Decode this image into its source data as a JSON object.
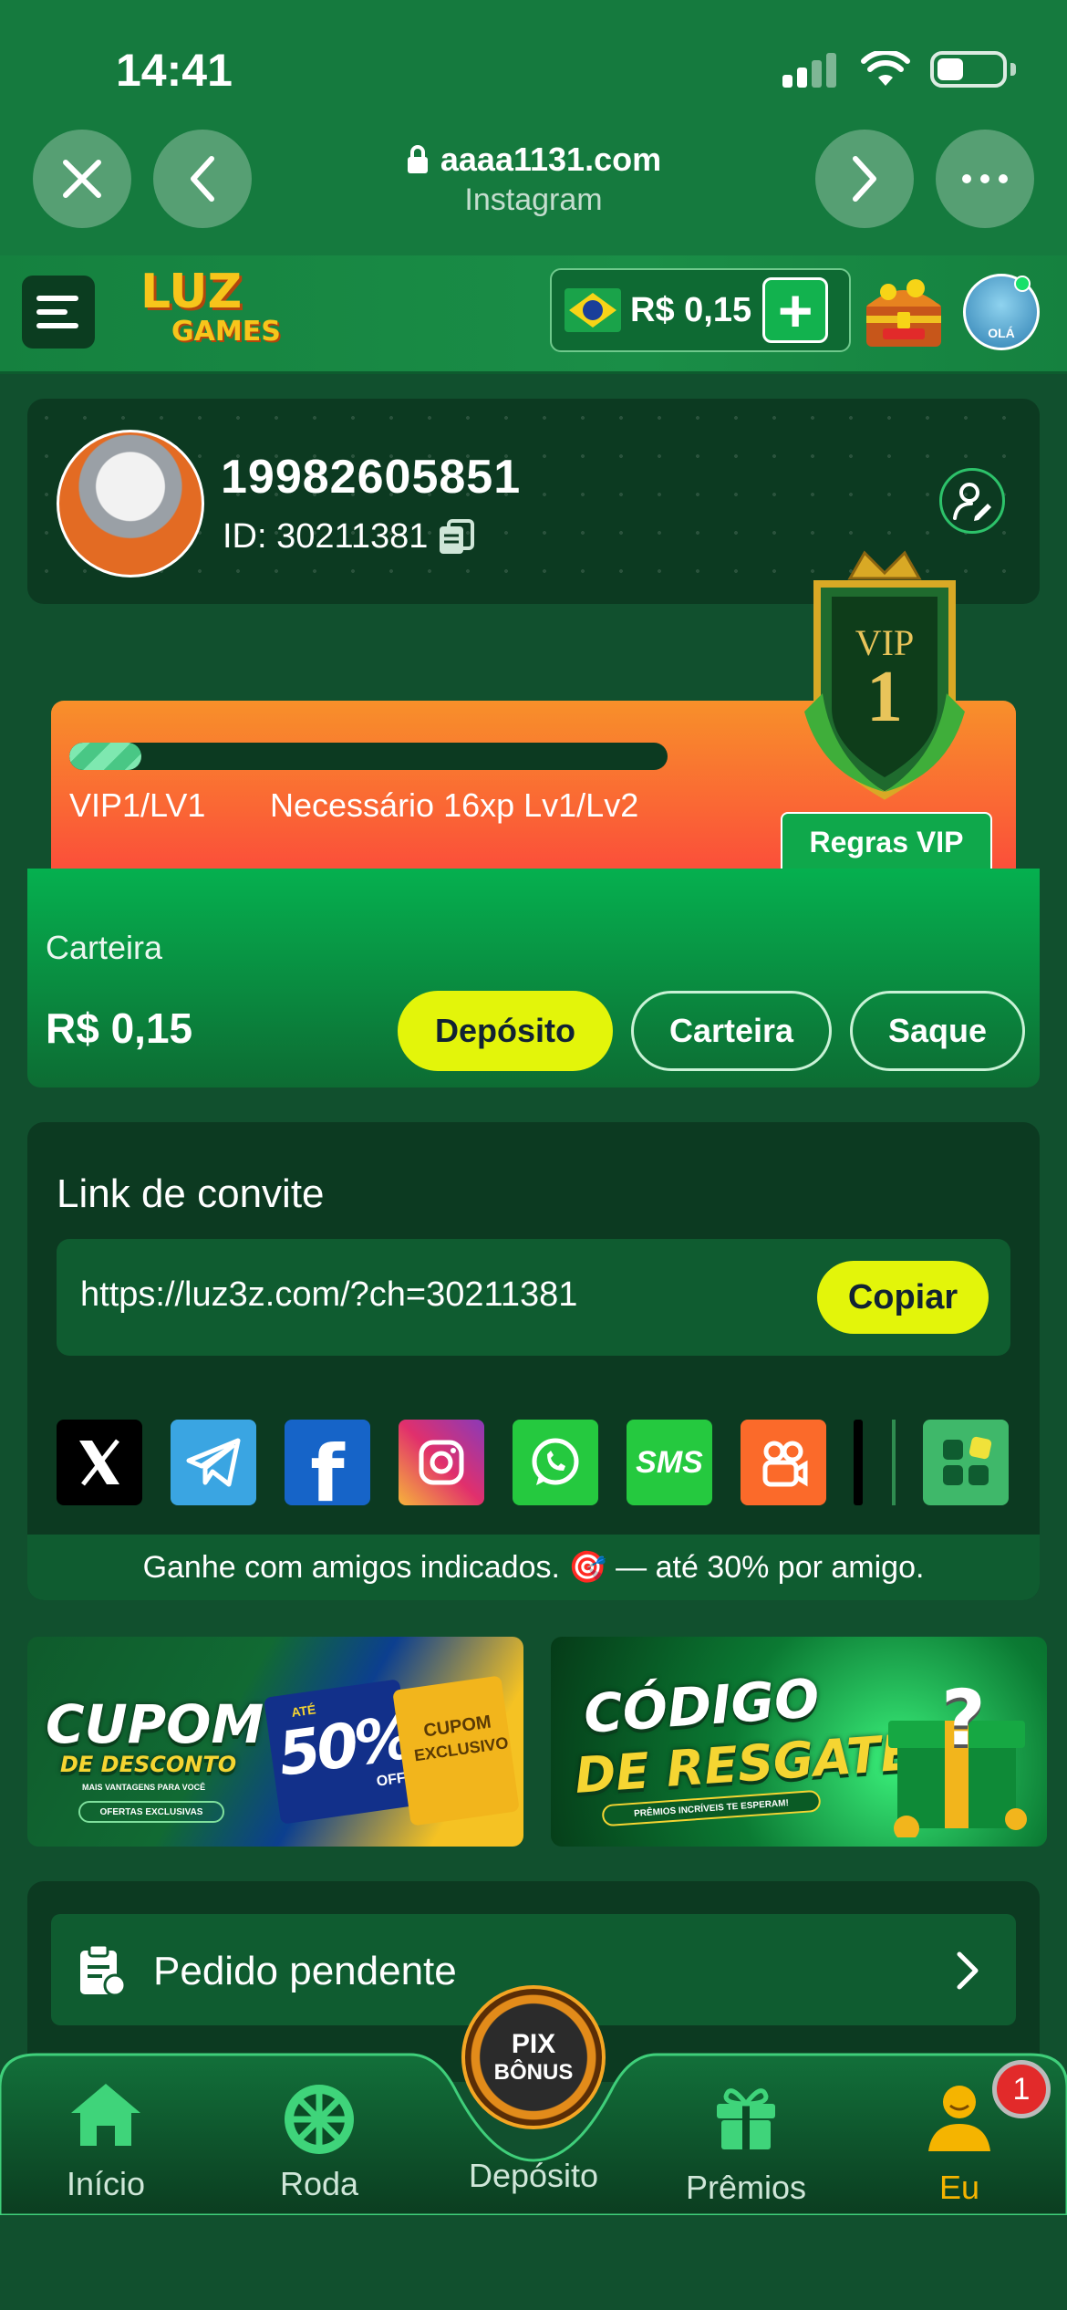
{
  "status_bar": {
    "time": "14:41"
  },
  "browser": {
    "url": "aaaa1131.com",
    "source": "Instagram"
  },
  "header": {
    "balance": "R$ 0,15",
    "plus_label": "+",
    "logo_line1": "LUZ",
    "logo_line2": "GAMES",
    "avatar_text": "OLÁ"
  },
  "profile": {
    "username": "19982605851",
    "id_text": "ID: 30211381"
  },
  "vip": {
    "progress_fraction": 0.12,
    "level_text": "VIP1/LV1",
    "need_text": "Necessário 16xp Lv1/Lv2",
    "rules_label": "Regras VIP",
    "badge_title": "VIP",
    "badge_number": "1"
  },
  "wallet": {
    "label": "Carteira",
    "balance": "R$ 0,15",
    "deposit_label": "Depósito",
    "wallet_label": "Carteira",
    "withdraw_label": "Saque"
  },
  "invite": {
    "title": "Link de convite",
    "url": "https://luz3z.com/?ch=30211381",
    "copy_label": "Copiar",
    "share_icons": [
      "x-icon",
      "telegram-icon",
      "facebook-icon",
      "instagram-icon",
      "whatsapp-icon",
      "sms-icon",
      "kwai-icon",
      "more-apps-icon"
    ],
    "sms_text": "SMS",
    "note": "Ganhe com amigos indicados. 🎯 — até 30% por amigo."
  },
  "banners": {
    "coupon": {
      "line1": "CUPOM",
      "line2": "DE DESCONTO",
      "sub": "MAIS VANTAGENS PARA VOCÊ",
      "ofertas": "OFERTAS EXCLUSIVAS",
      "ate": "ATÉ",
      "pct": "50%",
      "off": "OFF",
      "exclusive1": "CUPOM",
      "exclusive2": "EXCLUSIVO"
    },
    "code": {
      "line1": "CÓDIGO",
      "line2": "DE RESGATE",
      "sub": "PRÊMIOS INCRÍVEIS TE ESPERAM!",
      "mark": "?"
    }
  },
  "pending": {
    "label": "Pedido pendente"
  },
  "nav": {
    "items": [
      {
        "label": "Início",
        "icon": "home-icon"
      },
      {
        "label": "Roda",
        "icon": "wheel-icon"
      },
      {
        "label": "Depósito",
        "icon": "pix-bonus-icon"
      },
      {
        "label": "Prêmios",
        "icon": "gift-icon"
      },
      {
        "label": "Eu",
        "icon": "user-icon"
      }
    ],
    "center_top": "PIX",
    "center_bottom": "BÔNUS",
    "badge_count": "1",
    "active_color": "#f5b400"
  },
  "colors": {
    "accent_yellow": "#e3f50a",
    "brand_green": "#157a3e",
    "vip_orange": "#f8902a"
  }
}
